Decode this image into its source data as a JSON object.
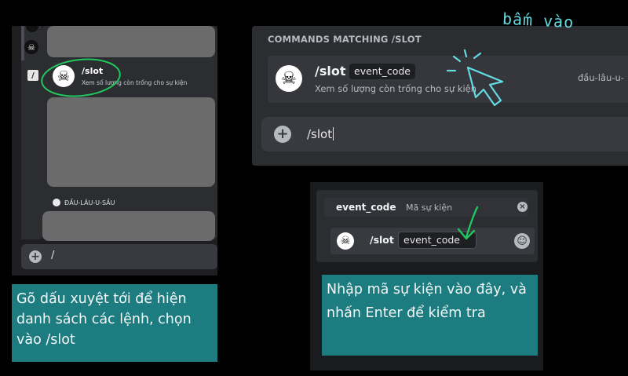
{
  "panel_left": {
    "command": {
      "name": "/slot",
      "description": "Xem số lượng còn trống cho sự kiện"
    },
    "bot_section_label": "ĐẦU-LÂU-U-SẦU",
    "input_text": "/",
    "caption": "Gõ dấu xuyệt tới để hiện danh sách các lệnh, chọn vào /slot"
  },
  "panel_top": {
    "heading": "COMMANDS MATCHING /SLOT",
    "command": {
      "name": "/slot",
      "option": "event_code",
      "description": "Xem số lượng còn trống cho sự kiện",
      "source": "đầu-lâu-u-"
    },
    "input_text": "/slot",
    "handwritten_note": "bấm vào"
  },
  "panel_bottom": {
    "option_header": {
      "name": "event_code",
      "description": "Mã sự kiện"
    },
    "input": {
      "command": "/slot",
      "option": "event_code"
    },
    "caption": "Nhập mã sự kiện vào đây, và nhấn Enter để kiểm tra"
  },
  "colors": {
    "caption_bg": "#1d7c80",
    "annotation_green": "#22c55e",
    "annotation_cyan": "#64dbe0",
    "discord_panel": "#2b2d31"
  }
}
